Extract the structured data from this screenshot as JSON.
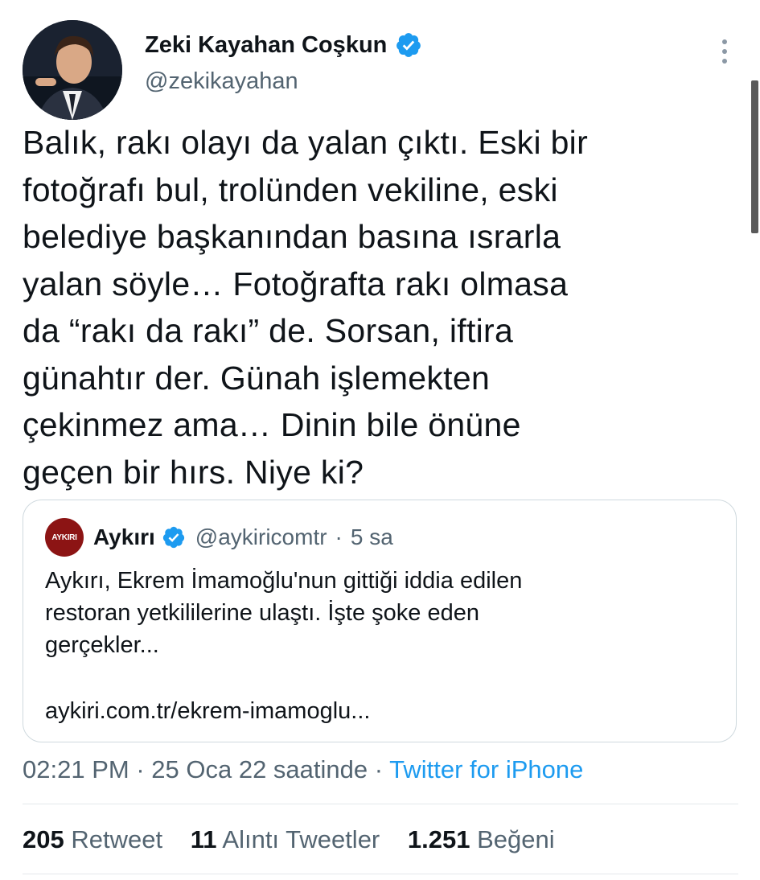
{
  "author": {
    "name": "Zeki Kayahan Coşkun",
    "handle": "@zekikayahan"
  },
  "icons": {
    "verified": "verified-badge-icon",
    "more": "more-vertical-icon"
  },
  "colors": {
    "accent": "#1d9bf0",
    "secondary_text": "#536471",
    "text": "#0f1419"
  },
  "tweet": {
    "lines": [
      "Balık, rakı olayı da yalan çıktı. Eski bir",
      "fotoğrafı bul, trolünden vekiline, eski",
      "belediye başkanından basına ısrarla",
      "yalan söyle… Fotoğrafta rakı olmasa",
      "da “rakı da rakı” de. Sorsan, iftira",
      "günahtır der. Günah işlemekten",
      "çekinmez ama… Dinin bile önüne",
      "geçen bir hırs. Niye ki?"
    ]
  },
  "quote": {
    "avatar_text": "AYKIRI",
    "name": "Aykırı",
    "handle": "@aykiricomtr",
    "separator": "·",
    "time": "5 sa",
    "lines": [
      "Aykırı, Ekrem İmamoğlu'nun gittiği iddia edilen",
      "restoran yetkililerine ulaştı. İşte şoke eden",
      "gerçekler..."
    ],
    "link": "aykiri.com.tr/ekrem-imamoglu..."
  },
  "meta": {
    "time": "02:21 PM",
    "sep1": " · ",
    "date": "25 Oca 22 saatinde",
    "sep2": " · ",
    "source": "Twitter for iPhone"
  },
  "stats": {
    "retweets": {
      "count": "205",
      "label": "Retweet"
    },
    "quotes": {
      "count": "11",
      "label": "Alıntı Tweetler"
    },
    "likes": {
      "count": "1.251",
      "label": "Beğeni"
    }
  }
}
